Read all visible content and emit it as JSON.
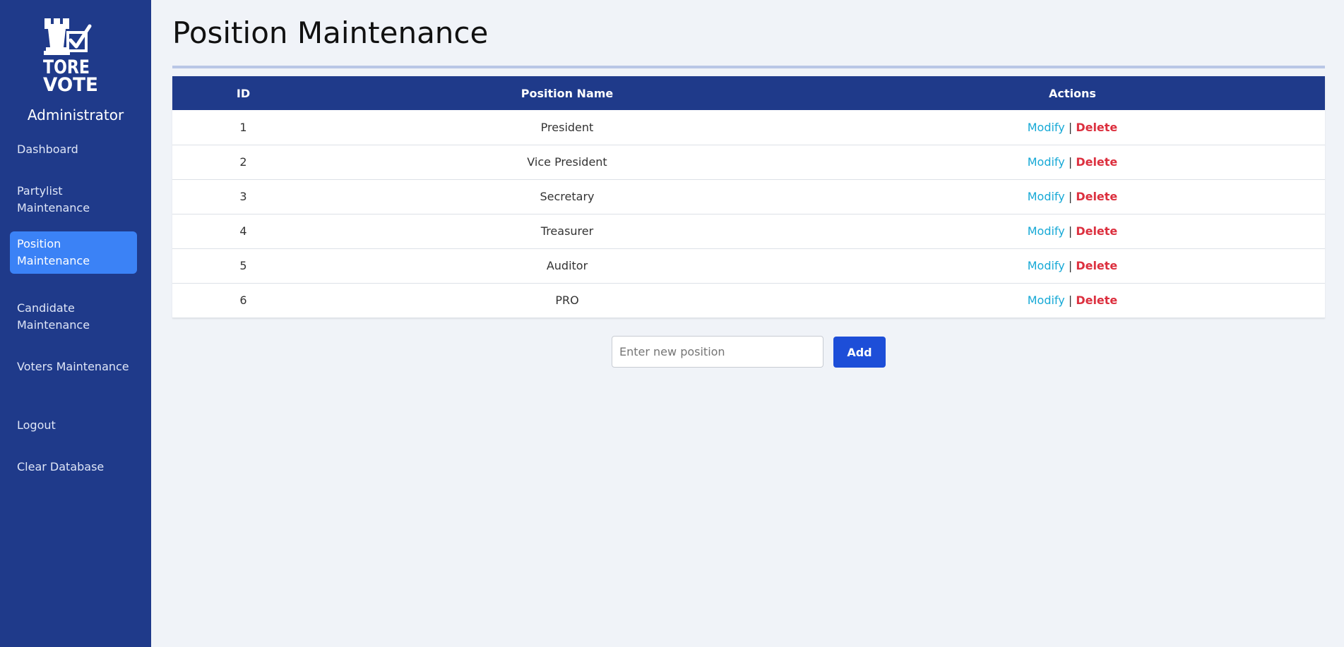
{
  "sidebar": {
    "logo": {
      "line1": "TORE",
      "line2": "VOTE",
      "icon": "rook-checkbox-icon"
    },
    "role": "Administrator",
    "items": [
      {
        "label": "Dashboard"
      },
      {
        "label": "Partylist Maintenance"
      },
      {
        "label": "Position Maintenance",
        "active": true
      },
      {
        "label": "Candidate Maintenance"
      },
      {
        "label": "Voters Maintenance"
      },
      {
        "label": "Logout"
      },
      {
        "label": "Clear Database"
      }
    ]
  },
  "page": {
    "title": "Position Maintenance"
  },
  "table": {
    "headers": {
      "id": "ID",
      "name": "Position Name",
      "actions": "Actions"
    },
    "rows": [
      {
        "id": "1",
        "name": "President"
      },
      {
        "id": "2",
        "name": "Vice President"
      },
      {
        "id": "3",
        "name": "Secretary"
      },
      {
        "id": "4",
        "name": "Treasurer"
      },
      {
        "id": "5",
        "name": "Auditor"
      },
      {
        "id": "6",
        "name": "PRO"
      }
    ],
    "actions": {
      "modify": "Modify",
      "separator": "|",
      "delete": "Delete"
    }
  },
  "add_form": {
    "placeholder": "Enter new position",
    "value": "",
    "button": "Add"
  },
  "colors": {
    "sidebar_bg": "#1f3a8a",
    "active_nav": "#3b82f6",
    "modify": "#17a9d6",
    "delete": "#dc2f3e",
    "add_button": "#1d4ed8"
  }
}
